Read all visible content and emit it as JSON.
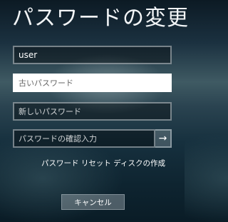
{
  "title": "パスワードの変更",
  "fields": {
    "user": {
      "value": "user"
    },
    "old_password": {
      "placeholder": "古いパスワード"
    },
    "new_password": {
      "placeholder": "新しいパスワード"
    },
    "confirm_password": {
      "placeholder": "パスワードの確認入力"
    }
  },
  "submit_icon": "arrow-right-icon",
  "submit_glyph": "→",
  "reset_link": "パスワード リセット ディスクの作成",
  "cancel_label": "キャンセル"
}
